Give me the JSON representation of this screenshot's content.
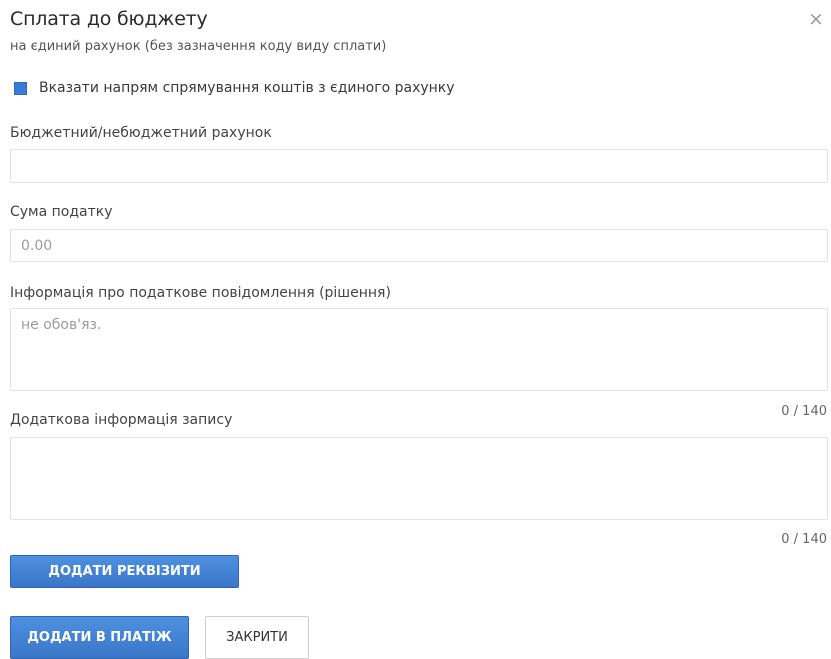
{
  "dialog": {
    "title": "Сплата до бюджету",
    "subtitle": "на єдиний рахунок (без зазначення коду виду сплати)",
    "close_glyph": "×"
  },
  "checkbox": {
    "label": "Вказати напрям спрямування коштів з єдиного рахунку",
    "checked": true
  },
  "fields": {
    "budget_account": {
      "label": "Бюджетний/небюджетний рахунок",
      "value": "",
      "placeholder": ""
    },
    "tax_amount": {
      "label": "Сума податку",
      "value": "",
      "placeholder": "0.00"
    },
    "tax_notice": {
      "label": "Інформація про податкове повідомлення (рішення)",
      "value": "",
      "placeholder": "не обов'яз.",
      "counter": "0 / 140"
    },
    "additional_info": {
      "label": "Додаткова інформація запису",
      "value": "",
      "placeholder": "",
      "counter": "0 / 140"
    }
  },
  "buttons": {
    "add_requisites": "ДОДАТИ РЕКВІЗИТИ",
    "add_to_payment": "ДОДАТИ В ПЛАТІЖ",
    "close": "ЗАКРИТИ"
  },
  "colors": {
    "accent": "#3a7bd5",
    "field_border": "#e2e2e2"
  }
}
